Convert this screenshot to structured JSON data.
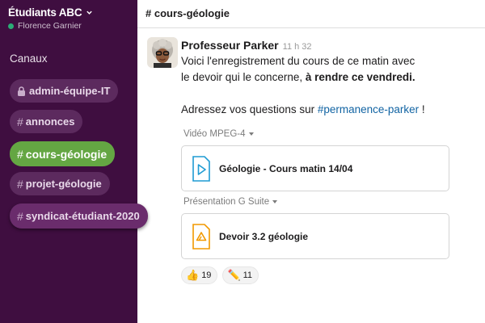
{
  "workspace": {
    "name": "Étudiants ABC",
    "user": "Florence Garnier"
  },
  "sidebar": {
    "section_title": "Canaux",
    "channels": [
      {
        "label": "admin-équipe-IT",
        "private": true
      },
      {
        "label": "annonces"
      },
      {
        "label": "cours-géologie",
        "active": true
      },
      {
        "label": "projet-géologie"
      },
      {
        "label": "syndicat-étudiant-2020"
      }
    ]
  },
  "header": {
    "channel_title": "# cours-géologie"
  },
  "message": {
    "author": "Professeur Parker",
    "time": "11 h 32",
    "line1": "Voici l'enregistrement du cours de ce matin avec",
    "line2_prefix": "le devoir qui le concerne, ",
    "line2_bold": "à rendre ce vendredi.",
    "line3_prefix": "Adressez vos questions sur ",
    "line3_link": "#permanence-parker",
    "line3_suffix": " !"
  },
  "attachments": [
    {
      "type_label": "Vidéo MPEG-4",
      "file_name": "Géologie - Cours matin 14/04",
      "icon": "video-play-icon"
    },
    {
      "type_label": "Présentation G Suite",
      "file_name": "Devoir 3.2 géologie",
      "icon": "slides-file-icon"
    }
  ],
  "reactions": [
    {
      "emoji": "👍",
      "count": "19"
    },
    {
      "emoji": "✏️",
      "count": "11"
    }
  ],
  "colors": {
    "sidebar": "#3f0e40",
    "active_channel": "#64a643",
    "link": "#1264a3"
  }
}
